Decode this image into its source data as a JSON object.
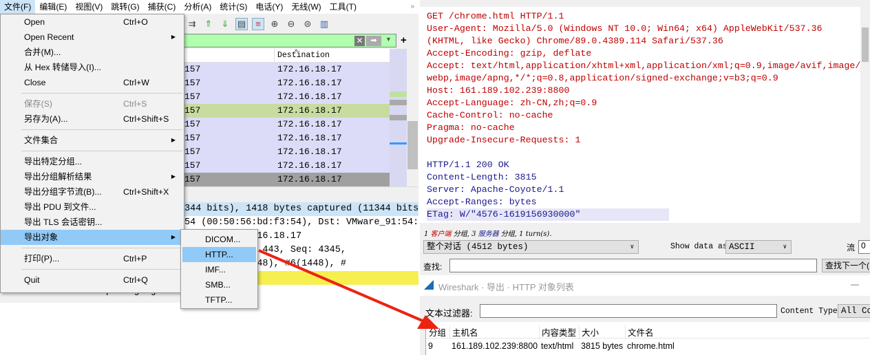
{
  "menubar": [
    "文件(F)",
    "编辑(E)",
    "视图(V)",
    "跳转(G)",
    "捕获(C)",
    "分析(A)",
    "统计(S)",
    "电话(Y)",
    "无线(W)",
    "工具(T)"
  ],
  "file_menu": [
    {
      "label": "Open",
      "shortcut": "Ctrl+O"
    },
    {
      "label": "Open Recent",
      "submenu": true
    },
    {
      "label": "合并(M)..."
    },
    {
      "label": "从 Hex 转储导入(I)..."
    },
    {
      "label": "Close",
      "shortcut": "Ctrl+W"
    },
    {
      "sep": true
    },
    {
      "label": "保存(S)",
      "shortcut": "Ctrl+S",
      "disabled": true
    },
    {
      "label": "另存为(A)...",
      "shortcut": "Ctrl+Shift+S"
    },
    {
      "sep": true
    },
    {
      "label": "文件集合",
      "submenu": true
    },
    {
      "sep": true
    },
    {
      "label": "导出特定分组..."
    },
    {
      "label": "导出分组解析结果",
      "submenu": true
    },
    {
      "label": "导出分组字节流(B)...",
      "shortcut": "Ctrl+Shift+X"
    },
    {
      "label": "导出 PDU 到文件..."
    },
    {
      "label": "导出 TLS 会话密钥..."
    },
    {
      "label": "导出对象",
      "submenu": true,
      "highlighted": true
    },
    {
      "sep": true
    },
    {
      "label": "打印(P)...",
      "shortcut": "Ctrl+P"
    },
    {
      "sep": true
    },
    {
      "label": "Quit",
      "shortcut": "Ctrl+Q"
    }
  ],
  "export_objects_submenu": [
    "DICOM...",
    "HTTP...",
    "IMF...",
    "SMB...",
    "TFTP..."
  ],
  "packet_list": {
    "dest_header": "Destination",
    "rows": [
      {
        "src": "157",
        "dst": "172.16.18.17",
        "style": "normal"
      },
      {
        "src": "157",
        "dst": "172.16.18.17",
        "style": "normal"
      },
      {
        "src": "157",
        "dst": "172.16.18.17",
        "style": "normal"
      },
      {
        "src": "157",
        "dst": "172.16.18.17",
        "style": "green"
      },
      {
        "src": "157",
        "dst": "172.16.18.17",
        "style": "normal"
      },
      {
        "src": "157",
        "dst": "172.16.18.17",
        "style": "normal"
      },
      {
        "src": "157",
        "dst": "172.16.18.17",
        "style": "normal"
      },
      {
        "src": "157",
        "dst": "172.16.18.17",
        "style": "normal"
      },
      {
        "src": "157",
        "dst": "172.16.18.17",
        "style": "dark"
      }
    ]
  },
  "details": [
    "344 bits), 1418 bytes captured (11344 bits",
    "54 (00:50:56:bd:f3:54), Dst: VMware_91:54:",
    "57, Dst: 172.16.18.17",
    "16, Dst Port: 443, Seq: 4345,",
    "(1448), #5(1448), #6(1448), #",
    "",
    "eXtensible Markup Language"
  ],
  "stream": {
    "request": [
      "GET /chrome.html HTTP/1.1",
      "User-Agent: Mozilla/5.0 (Windows NT 10.0; Win64; x64) AppleWebKit/537.36",
      "(KHTML, like Gecko) Chrome/89.0.4389.114 Safari/537.36",
      "Accept-Encoding: gzip, deflate",
      "Accept: text/html,application/xhtml+xml,application/xml;q=0.9,image/avif,image/",
      "webp,image/apng,*/*;q=0.8,application/signed-exchange;v=b3;q=0.9",
      "Host: 161.189.102.239:8800",
      "Accept-Language: zh-CN,zh;q=0.9",
      "Cache-Control: no-cache",
      "Pragma: no-cache",
      "Upgrade-Insecure-Requests: 1"
    ],
    "response": [
      "HTTP/1.1 200 OK",
      "Content-Length: 3815",
      "Server: Apache-Coyote/1.1",
      "Accept-Ranges: bytes",
      "ETag: W/\"4576-1619156930000\""
    ],
    "status_parts": [
      "1 ",
      "客户端",
      " 分组, 3 ",
      "服务器",
      " 分组, 1 turn(s)."
    ],
    "conversation": "整个对话 (4512 bytes)",
    "show_as_label": "Show data as",
    "show_as": "ASCII",
    "stream_label": "流",
    "stream_value": "0",
    "find_label": "查找:",
    "find_value": "",
    "find_next": "查找下一个("
  },
  "dialog": {
    "title": "Wireshark · 导出 · HTTP 对象列表",
    "minimize": "—",
    "filter_label": "文本过滤器:",
    "filter_value": "",
    "content_type_label": "Content Type:",
    "content_type": "All Con",
    "columns": [
      "分组",
      "主机名",
      "内容类型",
      "大小",
      "文件名"
    ],
    "rows": [
      [
        "9",
        "161.189.102.239:8800",
        "text/html",
        "3815 bytes",
        "chrome.html"
      ]
    ]
  },
  "colors": {
    "menu_highlight": "#91c9f7",
    "filter_green": "#afffaf",
    "request": "#c00000",
    "response": "#1a1a8c",
    "arrow": "#ee2211"
  }
}
